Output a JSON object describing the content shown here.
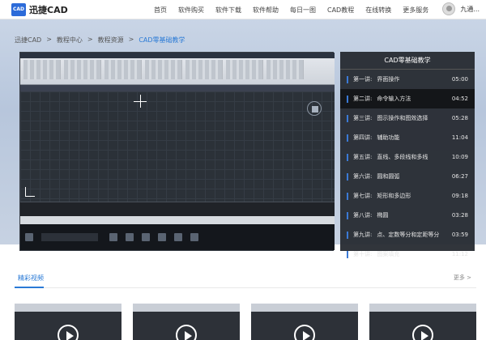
{
  "header": {
    "logo_badge": "CAD",
    "logo_text": "迅捷CAD",
    "nav": [
      "首页",
      "软件购买",
      "软件下载",
      "软件帮助",
      "每日一图",
      "CAD教程",
      "在线转换",
      "更多服务"
    ],
    "username": "九通..."
  },
  "breadcrumb": [
    "迅捷CAD",
    ">",
    "教程中心",
    ">",
    "教程资源",
    ">",
    "CAD零基础教学"
  ],
  "playlist": {
    "title": "CAD零基础教学",
    "items": [
      {
        "lesson": "第一讲:",
        "name": "界面操作",
        "duration": "05:00"
      },
      {
        "lesson": "第二讲:",
        "name": "命令输入方法",
        "duration": "04:52"
      },
      {
        "lesson": "第三讲:",
        "name": "图示操作和图效选择",
        "duration": "05:28"
      },
      {
        "lesson": "第四讲:",
        "name": "辅助功能",
        "duration": "11:04"
      },
      {
        "lesson": "第五讲:",
        "name": "直线、多段线和多线",
        "duration": "10:09"
      },
      {
        "lesson": "第六讲:",
        "name": "圆和圆弧",
        "duration": "06:27"
      },
      {
        "lesson": "第七讲:",
        "name": "矩形和多边形",
        "duration": "09:18"
      },
      {
        "lesson": "第八讲:",
        "name": "椭圆",
        "duration": "03:28"
      },
      {
        "lesson": "第九讲:",
        "name": "点、定数等分和定距等分",
        "duration": "03:59"
      },
      {
        "lesson": "第十讲:",
        "name": "图案填充",
        "duration": "11:12"
      }
    ],
    "active_index": 1
  },
  "section": {
    "title": "精彩视频",
    "more": "更多 >"
  }
}
